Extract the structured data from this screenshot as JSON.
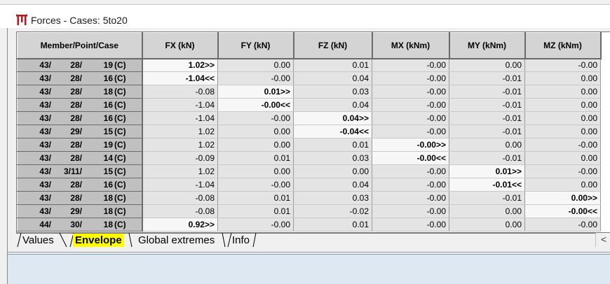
{
  "window": {
    "title": "Forces - Cases:  5to20",
    "icon": "structure-frame-icon"
  },
  "table": {
    "headers": [
      "Member/Point/Case",
      "FX (kN)",
      "FY (kN)",
      "FZ (kN)",
      "MX (kNm)",
      "MY (kNm)",
      "MZ (kNm)"
    ],
    "rows": [
      {
        "member": "43/",
        "point": "28/",
        "case": "19",
        "type": "(C)",
        "values": [
          "1.02>>",
          "0.00",
          "0.01",
          "-0.00",
          "0.00",
          "-0.00"
        ],
        "highlight": 0
      },
      {
        "member": "43/",
        "point": "28/",
        "case": "16",
        "type": "(C)",
        "values": [
          "-1.04<<",
          "-0.00",
          "0.04",
          "-0.00",
          "-0.01",
          "0.00"
        ],
        "highlight": 0
      },
      {
        "member": "43/",
        "point": "28/",
        "case": "18",
        "type": "(C)",
        "values": [
          "-0.08",
          "0.01>>",
          "0.03",
          "-0.00",
          "-0.01",
          "0.00"
        ],
        "highlight": 1
      },
      {
        "member": "43/",
        "point": "28/",
        "case": "16",
        "type": "(C)",
        "values": [
          "-1.04",
          "-0.00<<",
          "0.04",
          "-0.00",
          "-0.01",
          "0.00"
        ],
        "highlight": 1
      },
      {
        "member": "43/",
        "point": "28/",
        "case": "16",
        "type": "(C)",
        "values": [
          "-1.04",
          "-0.00",
          "0.04>>",
          "-0.00",
          "-0.01",
          "0.00"
        ],
        "highlight": 2
      },
      {
        "member": "43/",
        "point": "29/",
        "case": "15",
        "type": "(C)",
        "values": [
          "1.02",
          "0.00",
          "-0.04<<",
          "-0.00",
          "-0.01",
          "0.00"
        ],
        "highlight": 2
      },
      {
        "member": "43/",
        "point": "28/",
        "case": "19",
        "type": "(C)",
        "values": [
          "1.02",
          "0.00",
          "0.01",
          "-0.00>>",
          "0.00",
          "-0.00"
        ],
        "highlight": 3
      },
      {
        "member": "43/",
        "point": "28/",
        "case": "14",
        "type": "(C)",
        "values": [
          "-0.09",
          "0.01",
          "0.03",
          "-0.00<<",
          "-0.01",
          "0.00"
        ],
        "highlight": 3
      },
      {
        "member": "43/",
        "point": "3/11/",
        "case": "15",
        "type": "(C)",
        "values": [
          "1.02",
          "0.00",
          "0.00",
          "-0.00",
          "0.01>>",
          "-0.00"
        ],
        "highlight": 4
      },
      {
        "member": "43/",
        "point": "28/",
        "case": "16",
        "type": "(C)",
        "values": [
          "-1.04",
          "-0.00",
          "0.04",
          "-0.00",
          "-0.01<<",
          "0.00"
        ],
        "highlight": 4
      },
      {
        "member": "43/",
        "point": "28/",
        "case": "18",
        "type": "(C)",
        "values": [
          "-0.08",
          "0.01",
          "0.03",
          "-0.00",
          "-0.01",
          "0.00>>"
        ],
        "highlight": 5
      },
      {
        "member": "43/",
        "point": "29/",
        "case": "18",
        "type": "(C)",
        "values": [
          "-0.08",
          "0.01",
          "-0.02",
          "-0.00",
          "0.00",
          "-0.00<<"
        ],
        "highlight": 5
      },
      {
        "member": "44/",
        "point": "30/",
        "case": "18",
        "type": "(C)",
        "values": [
          "0.92>>",
          "-0.00",
          "0.01",
          "-0.00",
          "0.00",
          "-0.00"
        ],
        "highlight": 0
      }
    ]
  },
  "tabs": {
    "values": "Values",
    "envelope": "Envelope",
    "global_extremes": "Global extremes",
    "info": "Info",
    "active": "Envelope"
  },
  "scroll": {
    "left_arrow": "<"
  },
  "colors": {
    "active_tab_highlight": "#ffff00",
    "header_bg": "#d4d4d4",
    "key_bg": "#c0c0c0",
    "cell_bg": "#e4e4e4",
    "extreme_bg": "#f7f7f7",
    "status_panel": "#dde8f3"
  }
}
